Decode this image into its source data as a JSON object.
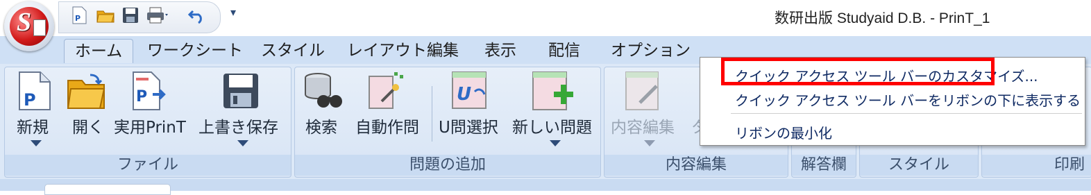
{
  "window": {
    "title": "数研出版 Studyaid D.B. - PrinT_1"
  },
  "qat": {
    "icons": [
      "new-doc-icon",
      "open-folder-icon",
      "save-icon",
      "print-icon",
      "undo-icon"
    ],
    "more_glyph": "▾"
  },
  "tabs": [
    "ホーム",
    "ワークシート",
    "スタイル",
    "レイアウト編集",
    "表示",
    "配信",
    "オプション"
  ],
  "ribbon": {
    "file": {
      "label": "ファイル",
      "buttons": [
        "新規",
        "開く",
        "実用PrinT",
        "上書き保存"
      ]
    },
    "add_problem": {
      "label": "問題の追加",
      "buttons": [
        "検索",
        "自動作問",
        "U問選択",
        "新しい問題"
      ]
    },
    "content_edit": {
      "label": "内容編集",
      "buttons": [
        "内容編集",
        "タ"
      ]
    },
    "answer": {
      "label": "解答欄"
    },
    "style": {
      "label": "スタイル"
    },
    "print": {
      "label": "印刷"
    }
  },
  "menu": {
    "items": [
      "クイック アクセス ツール バーのカスタマイズ...",
      "クイック アクセス ツール バーをリボンの下に表示する",
      "リボンの最小化"
    ],
    "highlight_color": "#ff0000"
  },
  "colors": {
    "ribbon_bg": "#dce8f7",
    "tabstrip_bg": "#cfe0f5",
    "accent": "#2d4b78"
  }
}
